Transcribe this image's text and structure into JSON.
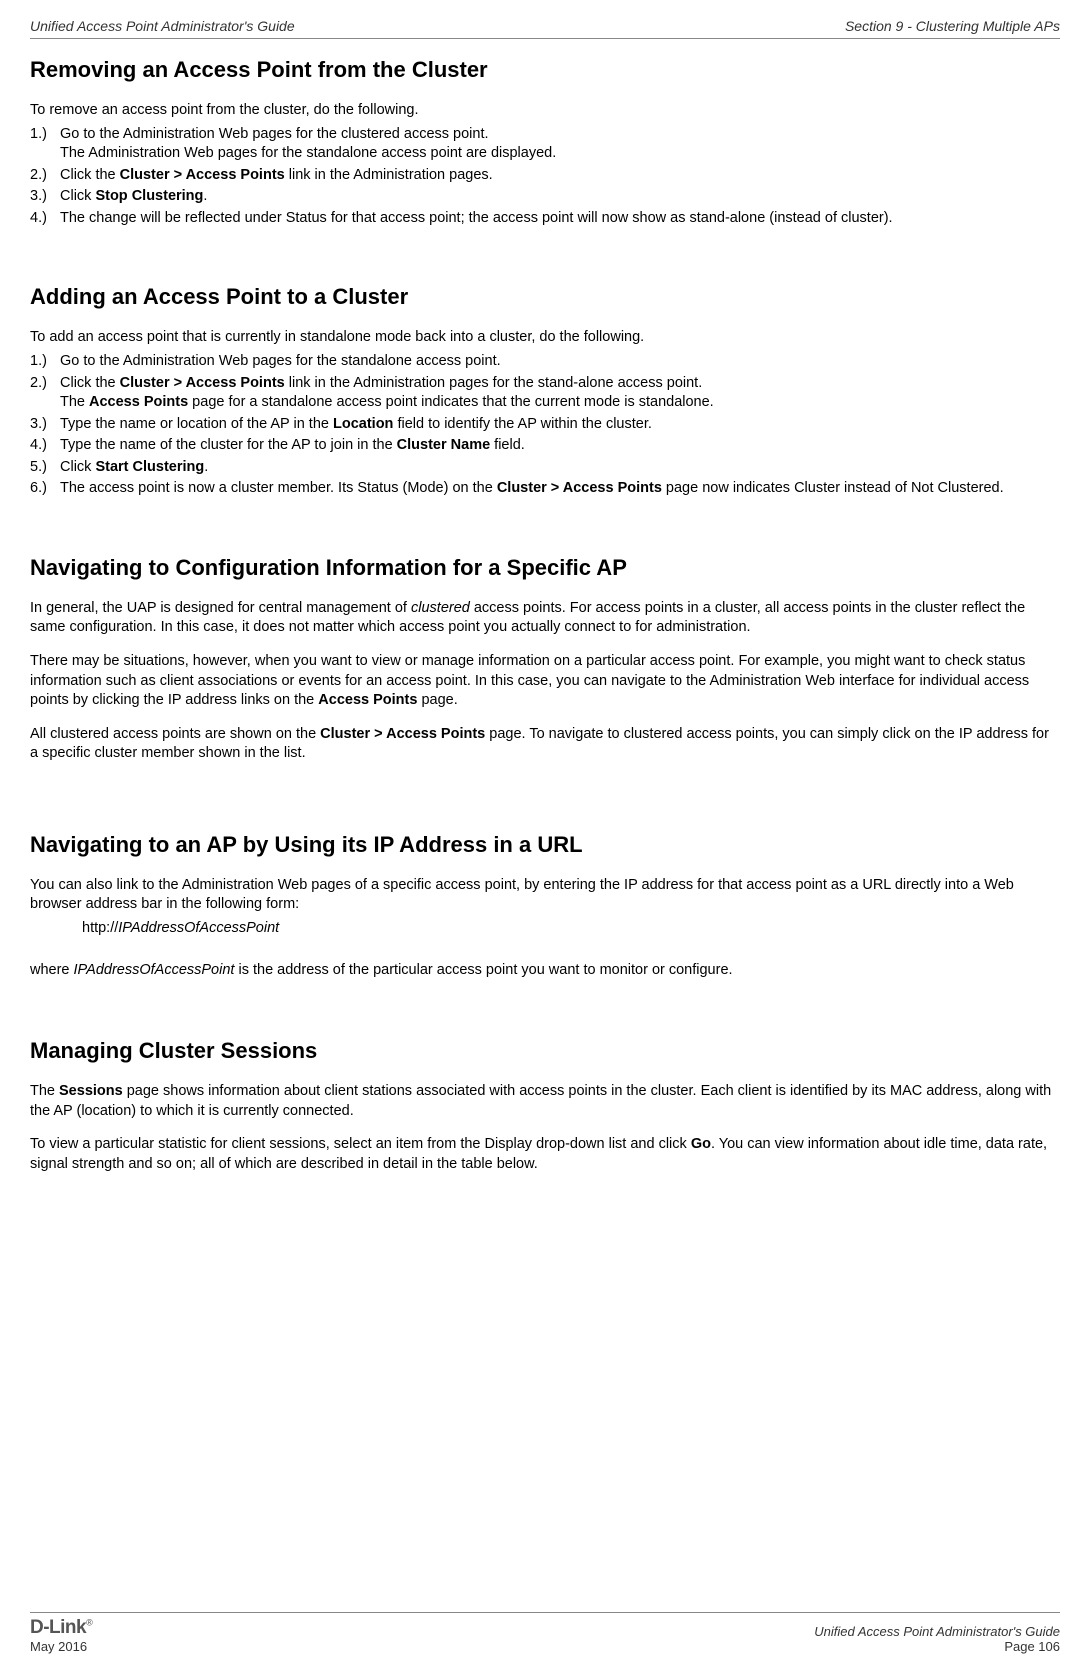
{
  "header": {
    "left": "Unified Access Point Administrator's Guide",
    "right": "Section 9 - Clustering Multiple APs"
  },
  "s1": {
    "title": "Removing an Access Point from the Cluster",
    "intro": "To remove an access point from the cluster, do the following.",
    "l1a": "Go to the Administration Web pages for the clustered access point.",
    "l1b": "The Administration Web pages for the standalone access point are displayed.",
    "l2a": "Click the ",
    "l2b": "Cluster > Access Points",
    "l2c": " link in the Administration pages.",
    "l3a": "Click ",
    "l3b": "Stop Clustering",
    "l3c": ".",
    "l4": "The change will be reflected under Status for that access point; the access point will now show as stand-alone (instead of cluster)."
  },
  "s2": {
    "title": "Adding an Access Point to a Cluster",
    "intro": "To add an access point that is currently in standalone mode back into a cluster, do the following.",
    "l1": "Go to the Administration Web pages for the standalone access point.",
    "l2a": "Click the ",
    "l2b": "Cluster > Access Points",
    "l2c": " link in the Administration pages for the stand-alone access point.",
    "l2d": "The ",
    "l2e": "Access Points",
    "l2f": " page for a standalone access point indicates that the current mode is standalone.",
    "l3a": "Type the name or location of the AP in the ",
    "l3b": "Location",
    "l3c": " field to identify the AP within the cluster.",
    "l4a": "Type the name of the cluster for the AP to join in the ",
    "l4b": "Cluster Name",
    "l4c": " field.",
    "l5a": "Click ",
    "l5b": "Start Clustering",
    "l5c": ".",
    "l6a": "The access point is now a cluster member. Its Status (Mode) on the ",
    "l6b": "Cluster > Access Points",
    "l6c": " page now indicates Cluster instead of Not Clustered."
  },
  "s3": {
    "title": "Navigating to Configuration Information for a Specific AP",
    "p1a": "In general, the UAP is designed for central management of ",
    "p1b": "clustered",
    "p1c": " access points. For access points in a cluster, all access points in the cluster reflect the same configuration. In this case, it does not matter which access point you actually connect to for administration.",
    "p2a": "There may be situations, however, when you want to view or manage information on a particular access point. For example, you might want to check status information such as client associations or events for an access point. In this case, you can navigate to the Administration Web interface for individual access points by clicking the IP address links on the ",
    "p2b": "Access Points",
    "p2c": " page.",
    "p3a": "All clustered access points are shown on the ",
    "p3b": "Cluster > Access Points",
    "p3c": " page. To navigate to clustered access points, you can simply click on the IP address for a specific cluster member shown in the list."
  },
  "s4": {
    "title": "Navigating to an AP by Using its IP Address in a URL",
    "p1": "You can also link to the Administration Web pages of a specific access point, by entering the IP address for that access point as a URL directly into a Web browser address bar in the following form:",
    "url_a": "http://",
    "url_b": "IPAddressOfAccessPoint",
    "p2a": "where ",
    "p2b": "IPAddressOfAccessPoint",
    "p2c": " is the address of the particular access point you want to monitor or configure."
  },
  "s5": {
    "title": "Managing Cluster Sessions",
    "p1a": "The ",
    "p1b": "Sessions",
    "p1c": " page shows information about client stations associated with access points in the cluster. Each client is identified by its MAC address, along with the AP (location) to which it is currently connected.",
    "p2a": "To view a particular statistic for client sessions, select an item from the Display drop-down list and click ",
    "p2b": "Go",
    "p2c": ". You can view information about idle time, data rate, signal strength and so on; all of which are described in detail in the table below."
  },
  "footer": {
    "date": "May 2016",
    "title": "Unified Access Point Administrator's Guide",
    "page": "Page 106",
    "logo": "D-Link"
  },
  "nums": {
    "n1": "1.)",
    "n2": "2.)",
    "n3": "3.)",
    "n4": "4.)",
    "n5": "5.)",
    "n6": "6.)"
  }
}
